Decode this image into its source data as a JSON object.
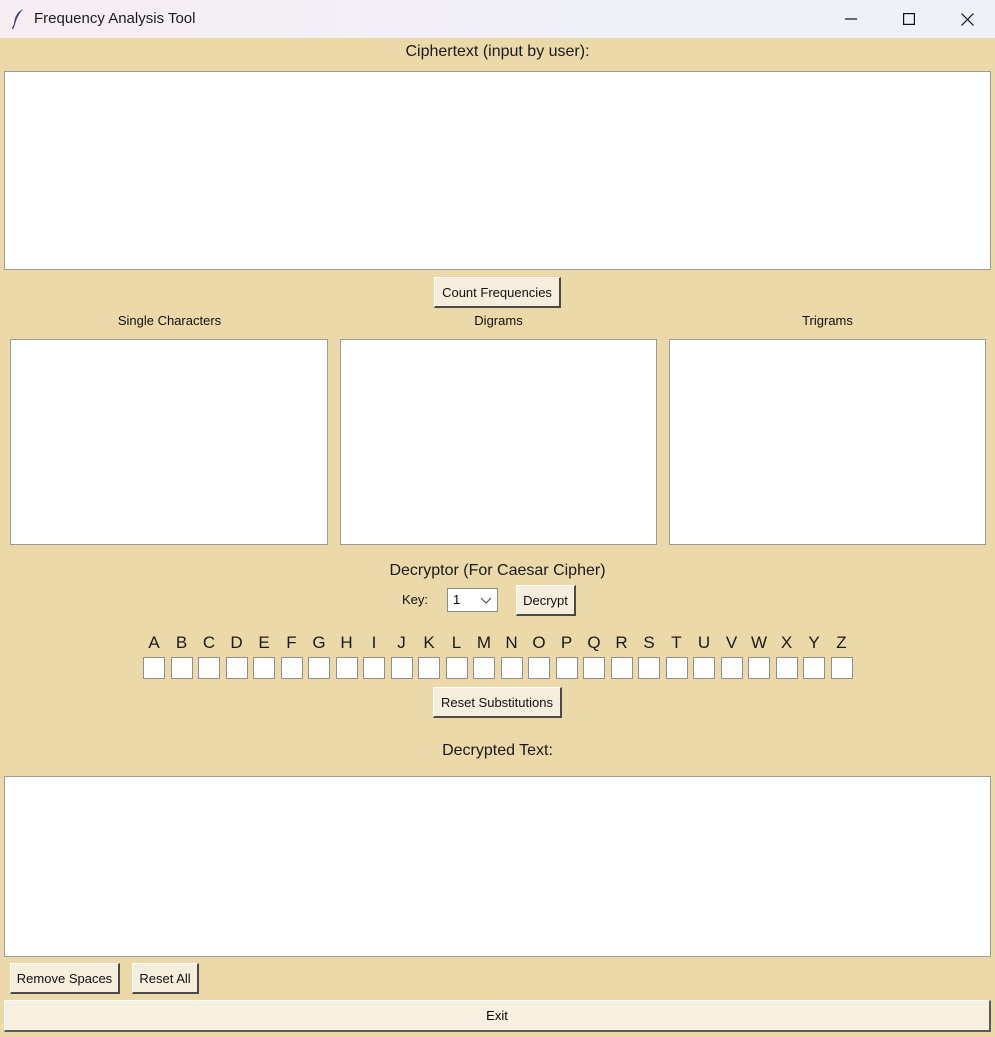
{
  "window": {
    "title": "Frequency Analysis Tool",
    "icon": "feather-icon",
    "controls": [
      "minimize-icon",
      "maximize-icon",
      "close-icon"
    ]
  },
  "ciphertext": {
    "label": "Ciphertext (input by user):",
    "value": ""
  },
  "count_button": "Count Frequencies",
  "frequency_panels": [
    {
      "label": "Single Characters",
      "value": ""
    },
    {
      "label": "Digrams",
      "value": ""
    },
    {
      "label": "Trigrams",
      "value": ""
    }
  ],
  "decryptor": {
    "title": "Decryptor (For Caesar Cipher)",
    "key_label": "Key:",
    "key_value": "1",
    "decrypt_button": "Decrypt"
  },
  "substitution": {
    "letters": [
      "A",
      "B",
      "C",
      "D",
      "E",
      "F",
      "G",
      "H",
      "I",
      "J",
      "K",
      "L",
      "M",
      "N",
      "O",
      "P",
      "Q",
      "R",
      "S",
      "T",
      "U",
      "V",
      "W",
      "X",
      "Y",
      "Z"
    ],
    "reset_button": "Reset Substitutions"
  },
  "decrypted": {
    "label": "Decrypted Text:",
    "value": ""
  },
  "bottom_buttons": {
    "remove_spaces": "Remove Spaces",
    "reset_all": "Reset All",
    "exit": "Exit"
  },
  "colors": {
    "background": "#ecd9aa",
    "button_face": "#f5eedd",
    "textbox": "#ffffff"
  }
}
